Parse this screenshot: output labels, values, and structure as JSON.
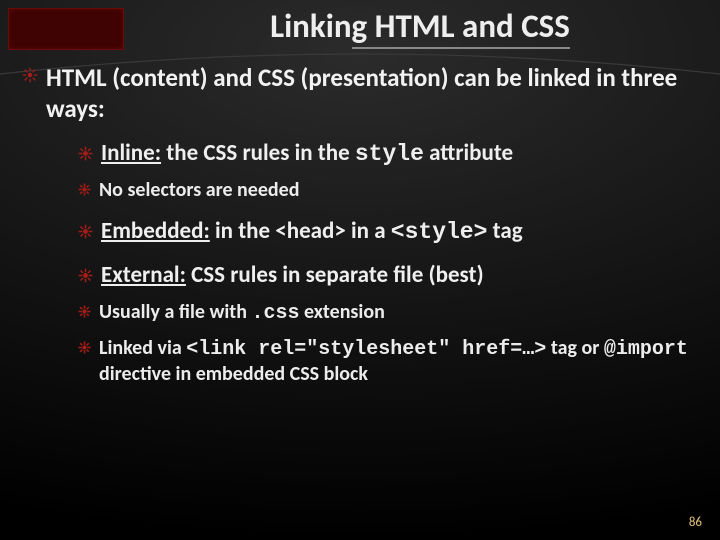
{
  "title": "Linking HTML and CSS",
  "title_prefix": "Linkin",
  "title_underlined": "g HTML and CSS",
  "bullets": {
    "b0": {
      "pre": "HTML",
      "mid": " (content) and CSS (presentation) can be linked in three ways:"
    },
    "b1": {
      "ul": "Inline:",
      "t1": " the CSS rules in the ",
      "mono": "style",
      "t2": " attribute"
    },
    "b1a": {
      "text": "No selectors are needed"
    },
    "b2": {
      "ul": "Embedded:",
      "t1": " in the <head> in a ",
      "mono": "<style>",
      "t2": " tag"
    },
    "b3": {
      "ul": "External:",
      "t1": " CSS rules in separate file (best)"
    },
    "b3a": {
      "t1": "Usually a file with ",
      "mono": ".css",
      "t2": " extension"
    },
    "b3b": {
      "t1": "Linked via ",
      "mono1": "<link rel=\"stylesheet\" href=…>",
      "t2": " tag or ",
      "mono2": "@import",
      "t3": " directive in embedded CSS block"
    }
  },
  "page_number": "86"
}
